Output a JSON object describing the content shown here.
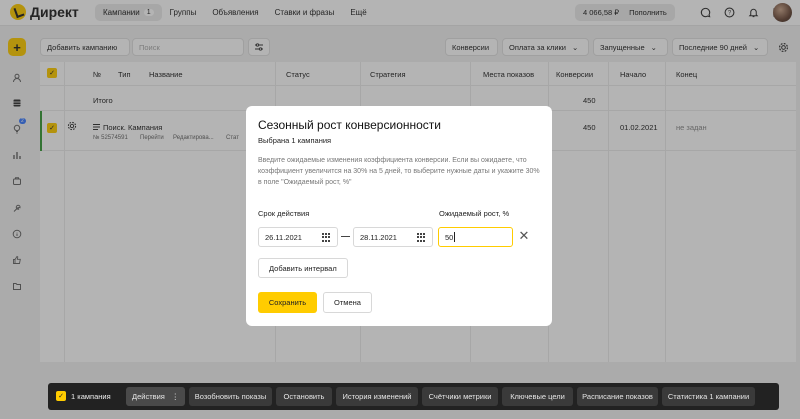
{
  "header": {
    "logo_text": "Директ",
    "nav": [
      {
        "label": "Кампании",
        "badge": "1",
        "active": true
      },
      {
        "label": "Группы"
      },
      {
        "label": "Объявления"
      },
      {
        "label": "Ставки и фразы"
      },
      {
        "label": "Ещё"
      }
    ],
    "balance": "4 066,58 ₽",
    "topup_label": "Пополнить",
    "icons": [
      "chat-icon",
      "help-icon",
      "bell-icon",
      "grid-icon"
    ]
  },
  "rail": {
    "add_label": "+",
    "icons": [
      "user-icon",
      "database-icon",
      "lightbulb-icon",
      "bar-chart-icon",
      "briefcase-icon",
      "wrench-icon",
      "info-icon",
      "thumbs-up-icon",
      "folder-icon"
    ],
    "badge": "2"
  },
  "toolbar": {
    "add_campaign": "Добавить кампанию",
    "search_placeholder": "Поиск",
    "conversions": "Конверсии",
    "payment": "Оплата за клики",
    "status": "Запущенные",
    "period": "Последние 90 дней"
  },
  "table": {
    "headers": [
      "№",
      "Тип",
      "Название",
      "Статус",
      "Стратегия",
      "Места показов",
      "Конверсии",
      "Начало",
      "Конец"
    ],
    "total": {
      "label": "Итого",
      "conversions": "450"
    },
    "campaign": {
      "type": "Поиск. Кампания",
      "meta": [
        "№ 52574591",
        "Перейти",
        "Редактирова...",
        "Стат"
      ],
      "conversions": "450",
      "start": "01.02.2021",
      "end": "не задан"
    }
  },
  "modal": {
    "title": "Сезонный рост конверсионности",
    "subtitle": "Выбрана 1 кампания",
    "description": "Введите ожидаемые изменения коэффициента конверсии. Если вы ожидаете, что коэффициент увеличится на 30% на 5 дней, то выберите нужные даты и укажите 30% в поле \"Ожидаемый рост, %\"",
    "period_label": "Срок действия",
    "growth_label": "Ожидаемый рост, %",
    "date_from": "26.11.2021",
    "date_to": "28.11.2021",
    "growth_value": "50",
    "add_interval": "Добавить интервал",
    "save": "Сохранить",
    "cancel": "Отмена"
  },
  "bottombar": {
    "count": "1 кампания",
    "actions": [
      "Действия",
      "Возобновить показы",
      "Остановить",
      "История изменений",
      "Счётчики метрики",
      "Ключевые цели",
      "Расписание показов",
      "Статистика 1 кампании"
    ]
  },
  "colors": {
    "accent": "#ffcc00",
    "active_row": "#3a9b3a",
    "badge": "#3b7bff"
  }
}
